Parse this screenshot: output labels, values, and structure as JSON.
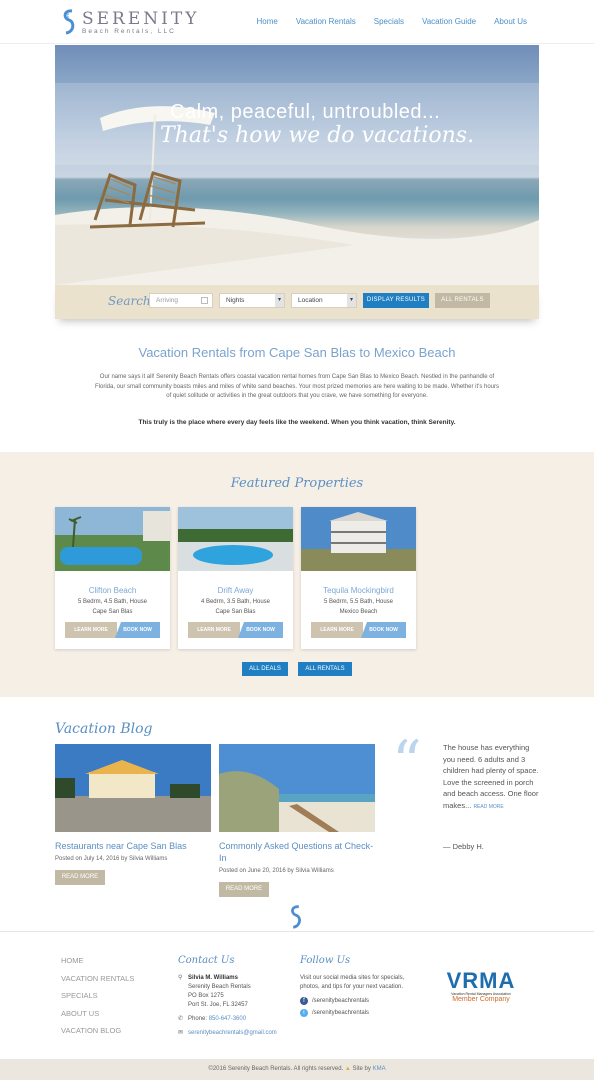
{
  "brand": {
    "name": "Serenity",
    "sub": "Beach Rentals, LLC"
  },
  "nav": [
    "Home",
    "Vacation Rentals",
    "Specials",
    "Vacation Guide",
    "About Us"
  ],
  "hero": {
    "line1": "Calm, peaceful, untroubled...",
    "line2": "That's how we do vacations."
  },
  "search": {
    "label": "Search:",
    "arriving": "Arriving",
    "nights": "Nights",
    "location": "Location",
    "display_btn": "DISPLAY RESULTS",
    "all_btn": "ALL RENTALS"
  },
  "intro": {
    "title": "Vacation Rentals from Cape San Blas to Mexico Beach",
    "body": "Our name says it all! Serenity Beach Rentals offers coastal vacation rental homes from Cape San Blas to Mexico Beach. Nestled in the panhandle of Florida, our small community boasts miles and miles of white sand beaches. Your most prized memories are here waiting to be made. Whether it's hours of quiet solitude or activities in the great outdoors that you crave, we have something for everyone.",
    "tagline": "This truly is the place where every day feels like the weekend. When you think vacation, think Serenity."
  },
  "featured": {
    "title": "Featured Properties",
    "cards": [
      {
        "name": "Clifton Beach",
        "info": "5 Bedrm, 4.5 Bath, House",
        "loc": "Cape San Blas",
        "more": "LEARN MORE",
        "book": "BOOK NOW"
      },
      {
        "name": "Drift Away",
        "info": "4 Bedrm, 3.5 Bath, House",
        "loc": "Cape San Blas",
        "more": "LEARN MORE",
        "book": "BOOK NOW"
      },
      {
        "name": "Tequila Mockingbird",
        "info": "5 Bedrm, 5.5 Bath, House",
        "loc": "Mexico Beach",
        "more": "LEARN MORE",
        "book": "BOOK NOW"
      }
    ],
    "deals_btn": "ALL DEALS",
    "rentals_btn": "ALL RENTALS"
  },
  "blog": {
    "title": "Vacation Blog",
    "posts": [
      {
        "title": "Restaurants near Cape San Blas",
        "date": "Posted on July 14, 2016 by Silvia Williams",
        "btn": "READ MORE"
      },
      {
        "title": "Commonly Asked Questions at Check-In",
        "date": "Posted on June 20, 2016 by Silvia Williams",
        "btn": "READ MORE"
      }
    ],
    "quote": "The house has everything you need. 6 adults and 3 children had plenty of space. Love the screened in porch and beach access. One floor makes...",
    "quote_more": "READ MORE",
    "quote_by": "— Debby H."
  },
  "footer": {
    "nav": [
      "HOME",
      "VACATION RENTALS",
      "SPECIALS",
      "ABOUT US",
      "VACATION BLOG"
    ],
    "contact_title": "Contact Us",
    "contact_name": "Silvia M. Williams",
    "contact_lines": [
      "Serenity Beach Rentals",
      "PO Box 1275",
      "Port St. Joe, FL 32457"
    ],
    "phone_label": "Phone:",
    "phone": "850-647-3600",
    "email": "serenitybeachrentals@gmail.com",
    "follow_title": "Follow Us",
    "follow_text": "Visit our social media sites for specials, photos, and tips for your next vacation.",
    "facebook": "/serenitybeachrentals",
    "twitter": "/serenitybeachrentals",
    "vrma_name": "VRMA",
    "vrma_full": "Vacation Rental Managers Association",
    "vrma_member": "Member Company"
  },
  "copyright": {
    "text": "©2016 Serenity Beach Rentals. All rights reserved.",
    "site_by": "Site by",
    "kma": "KMA"
  }
}
